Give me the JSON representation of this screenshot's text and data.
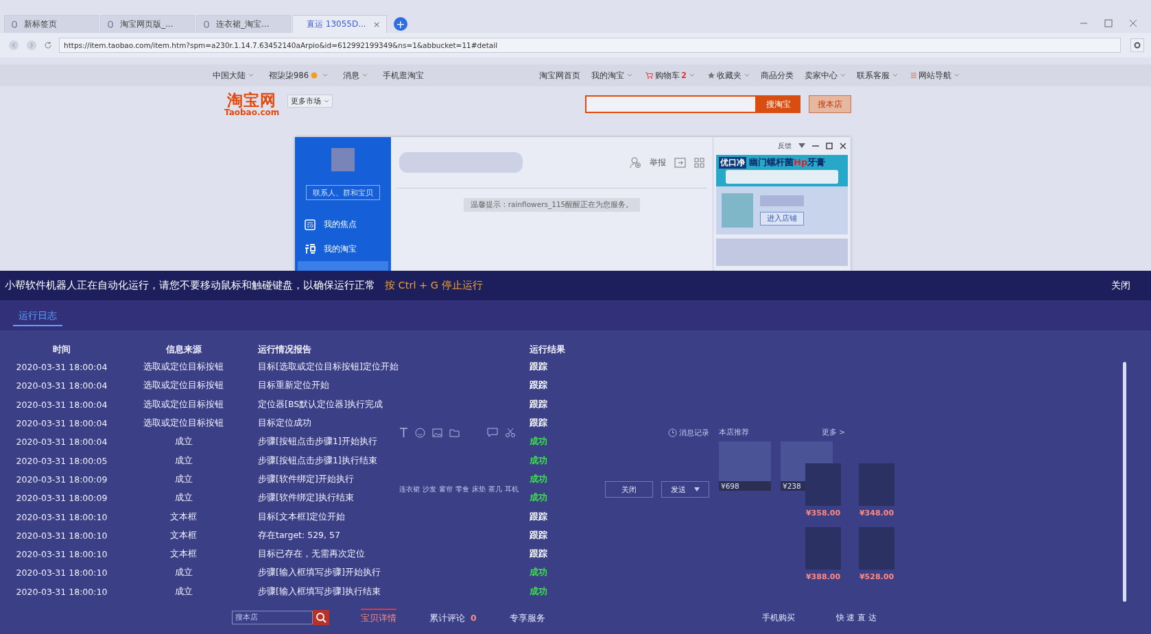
{
  "browser": {
    "tabs": [
      {
        "title": "新标签页",
        "selected": false
      },
      {
        "title": "淘宝网页版_...",
        "selected": false
      },
      {
        "title": "连衣裙_淘宝...",
        "selected": false
      },
      {
        "title": "直运 13055D...",
        "selected": true
      }
    ],
    "tab_close": "×",
    "new_tab": "+",
    "url": "https://item.taobao.com/item.htm?spm=a230r.1.14.7.63452140aArpio&id=612992199349&ns=1&abbucket=11#detail"
  },
  "site_nav": {
    "left": [
      {
        "label": "中国大陆",
        "dropdown": true,
        "kind": "plain"
      },
      {
        "label": "褶柒柒986",
        "dropdown": true,
        "kind": "badge"
      },
      {
        "label": "消息",
        "dropdown": true,
        "kind": "plain"
      },
      {
        "label": "手机逛淘宝",
        "dropdown": false,
        "kind": "plain"
      }
    ],
    "right": [
      {
        "label": "淘宝网首页",
        "dropdown": false,
        "kind": "plain"
      },
      {
        "label": "我的淘宝",
        "dropdown": true,
        "kind": "plain"
      },
      {
        "label": "购物车",
        "count": "2",
        "dropdown": true,
        "kind": "cart"
      },
      {
        "label": "收藏夹",
        "dropdown": true,
        "kind": "star"
      },
      {
        "label": "商品分类",
        "dropdown": false,
        "kind": "plain"
      },
      {
        "label": "卖家中心",
        "dropdown": true,
        "kind": "plain"
      },
      {
        "label": "联系客服",
        "dropdown": true,
        "kind": "plain"
      },
      {
        "label": "网站导航",
        "dropdown": true,
        "kind": "menu"
      }
    ]
  },
  "header": {
    "logo": "淘宝网",
    "logo_domain": "Taobao.com",
    "market": "更多市场",
    "search_buttons": [
      "搜淘宝",
      "搜本店"
    ]
  },
  "chat": {
    "feedback": "反馈",
    "search_placeholder": "联系人、群和宝贝",
    "nav": [
      {
        "label": "我的焦点",
        "kind": "focus"
      },
      {
        "label": "我的淘宝",
        "kind": "taobao"
      }
    ],
    "report": "举报",
    "notice": "温馨提示：rainflowers_115醒醒正在为您服务。",
    "ad": {
      "brand": "优口净",
      "title": "幽门螺杆菌",
      "highlight": "Hp",
      "suffix": "牙膏"
    },
    "enter_shop": "进入店铺",
    "history": "消息记录",
    "quick_words": [
      "连衣裙",
      "沙发",
      "窗帘",
      "零食",
      "床垫",
      "茶几",
      "耳机"
    ],
    "close": "关闭",
    "send": "发送",
    "recommend": "本店推荐",
    "more": "更多 >",
    "products": [
      {
        "price": "¥698"
      },
      {
        "price": "¥238"
      }
    ]
  },
  "page": {
    "shop_prices": [
      "¥358.00",
      "¥348.00",
      "¥388.00",
      "¥528.00"
    ],
    "shop_search_placeholder": "搜本店",
    "tabs": [
      {
        "label": "宝贝详情",
        "selected": true
      },
      {
        "label": "累计评论",
        "count": "0",
        "selected": false
      },
      {
        "label": "专享服务",
        "selected": false
      }
    ],
    "mobile_buy": "手机购买",
    "quick_nav": "快 速 直 达"
  },
  "banner": {
    "message": "小帮软件机器人正在自动化运行，请您不要移动鼠标和触碰键盘，以确保运行正常",
    "hint": "按 Ctrl + G 停止运行",
    "close": "关闭"
  },
  "log": {
    "tab": "运行日志",
    "columns": [
      "时间",
      "信息来源",
      "运行情况报告",
      "运行结果"
    ],
    "rows": [
      {
        "time": "2020-03-31 18:00:04",
        "source": "选取或定位目标按钮",
        "report": "目标[选取或定位目标按钮]定位开始",
        "result": "跟踪",
        "kind": "trace"
      },
      {
        "time": "2020-03-31 18:00:04",
        "source": "选取或定位目标按钮",
        "report": "目标重新定位开始",
        "result": "跟踪",
        "kind": "trace"
      },
      {
        "time": "2020-03-31 18:00:04",
        "source": "选取或定位目标按钮",
        "report": "定位器[BS默认定位器]执行完成",
        "result": "跟踪",
        "kind": "trace"
      },
      {
        "time": "2020-03-31 18:00:04",
        "source": "选取或定位目标按钮",
        "report": "目标定位成功",
        "result": "跟踪",
        "kind": "trace"
      },
      {
        "time": "2020-03-31 18:00:04",
        "source": "成立",
        "report": "步骤[按钮点击步骤1]开始执行",
        "result": "成功",
        "kind": "success"
      },
      {
        "time": "2020-03-31 18:00:05",
        "source": "成立",
        "report": "步骤[按钮点击步骤1]执行结束",
        "result": "成功",
        "kind": "success"
      },
      {
        "time": "2020-03-31 18:00:09",
        "source": "成立",
        "report": "步骤[软件绑定]开始执行",
        "result": "成功",
        "kind": "success"
      },
      {
        "time": "2020-03-31 18:00:09",
        "source": "成立",
        "report": "步骤[软件绑定]执行结束",
        "result": "成功",
        "kind": "success"
      },
      {
        "time": "2020-03-31 18:00:10",
        "source": "文本框",
        "report": "目标[文本框]定位开始",
        "result": "跟踪",
        "kind": "trace"
      },
      {
        "time": "2020-03-31 18:00:10",
        "source": "文本框",
        "report": "存在target: 529, 57",
        "result": "跟踪",
        "kind": "trace"
      },
      {
        "time": "2020-03-31 18:00:10",
        "source": "文本框",
        "report": "目标已存在，无需再次定位",
        "result": "跟踪",
        "kind": "trace"
      },
      {
        "time": "2020-03-31 18:00:10",
        "source": "成立",
        "report": "步骤[输入框填写步骤]开始执行",
        "result": "成功",
        "kind": "success"
      },
      {
        "time": "2020-03-31 18:00:10",
        "source": "成立",
        "report": "步骤[输入框填写步骤]执行结束",
        "result": "成功",
        "kind": "success"
      }
    ]
  }
}
